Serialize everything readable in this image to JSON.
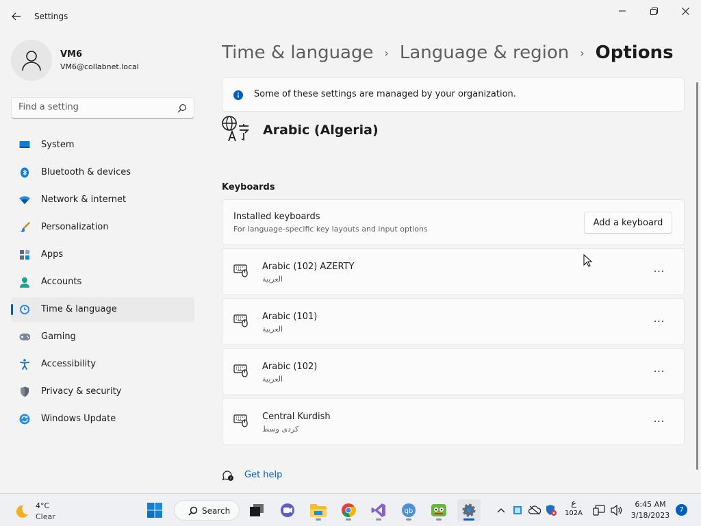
{
  "window": {
    "title": "Settings",
    "controls": {
      "minimize": "minimize-icon",
      "maximize": "restore-icon",
      "close": "close-icon"
    }
  },
  "profile": {
    "name": "VM6",
    "email": "VM6@collabnet.local"
  },
  "search": {
    "placeholder": "Find a setting"
  },
  "sidebar": {
    "items": [
      {
        "label": "System",
        "icon": "system-icon"
      },
      {
        "label": "Bluetooth & devices",
        "icon": "bluetooth-icon"
      },
      {
        "label": "Network & internet",
        "icon": "wifi-icon"
      },
      {
        "label": "Personalization",
        "icon": "brush-icon"
      },
      {
        "label": "Apps",
        "icon": "apps-icon"
      },
      {
        "label": "Accounts",
        "icon": "accounts-icon"
      },
      {
        "label": "Time & language",
        "icon": "time-language-icon",
        "active": true
      },
      {
        "label": "Gaming",
        "icon": "gamepad-icon"
      },
      {
        "label": "Accessibility",
        "icon": "accessibility-icon"
      },
      {
        "label": "Privacy & security",
        "icon": "shield-icon"
      },
      {
        "label": "Windows Update",
        "icon": "update-icon"
      }
    ]
  },
  "breadcrumb": {
    "items": [
      "Time & language",
      "Language & region",
      "Options"
    ],
    "separator": "›"
  },
  "notice": {
    "text": "Some of these settings are managed by your organization."
  },
  "language": {
    "name": "Arabic (Algeria)"
  },
  "keyboards": {
    "section_title": "Keyboards",
    "installed_title": "Installed keyboards",
    "installed_desc": "For language-specific key layouts and input options",
    "add_button": "Add a keyboard",
    "list": [
      {
        "name": "Arabic (102) AZERTY",
        "native": "العربية"
      },
      {
        "name": "Arabic (101)",
        "native": "العربية"
      },
      {
        "name": "Arabic (102)",
        "native": "العربية"
      },
      {
        "name": "Central Kurdish",
        "native": "کردی وسط"
      }
    ],
    "more_label": "···"
  },
  "help": {
    "label": "Get help"
  },
  "taskbar": {
    "weather": {
      "temp": "4°C",
      "condition": "Clear"
    },
    "search_label": "Search",
    "ime": {
      "line1": "ع",
      "line2": "102A"
    },
    "clock": {
      "time": "6:45 AM",
      "date": "3/18/2023"
    },
    "notifications": "7"
  },
  "colors": {
    "accent": "#005fb8",
    "background": "#f3f3f3",
    "card": "#fbfbfb"
  }
}
